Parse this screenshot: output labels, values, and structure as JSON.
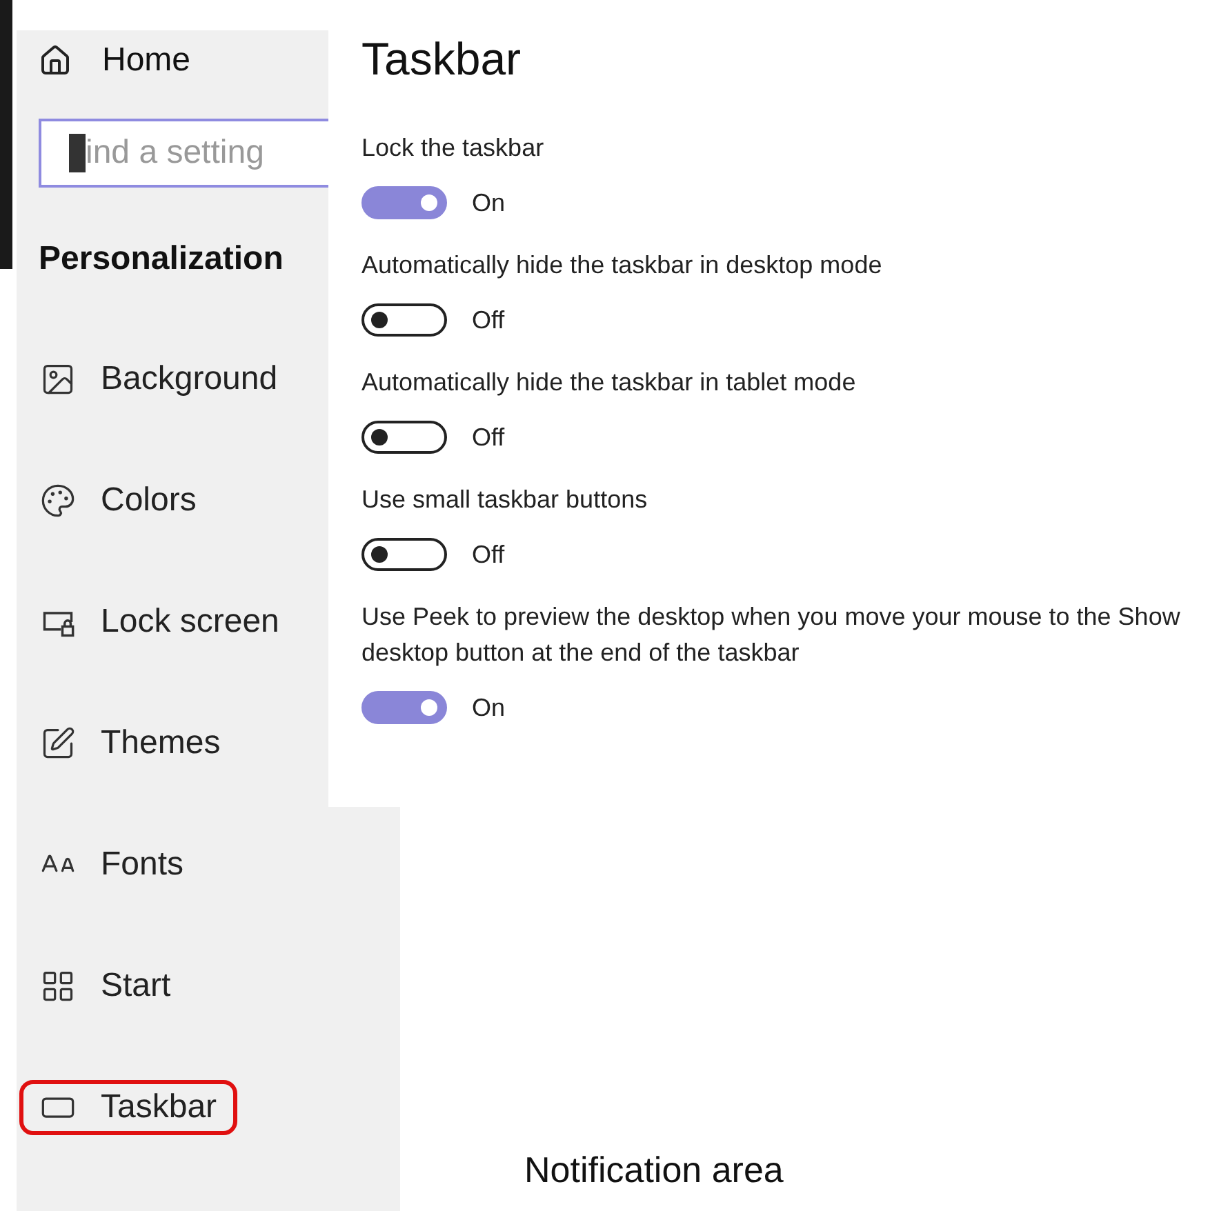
{
  "sidebar": {
    "home": "Home",
    "search": {
      "placeholder": "ind a setting"
    },
    "section": "Personalization",
    "items": [
      {
        "kind": "background",
        "label": "Background",
        "selected": false
      },
      {
        "kind": "colors",
        "label": "Colors",
        "selected": false
      },
      {
        "kind": "lockscreen",
        "label": "Lock screen",
        "selected": false
      },
      {
        "kind": "themes",
        "label": "Themes",
        "selected": false
      },
      {
        "kind": "fonts",
        "label": "Fonts",
        "selected": false
      },
      {
        "kind": "start",
        "label": "Start",
        "selected": false
      },
      {
        "kind": "taskbar",
        "label": "Taskbar",
        "selected": true
      }
    ]
  },
  "panel": {
    "title": "Taskbar",
    "settings": [
      {
        "label": "Lock the taskbar",
        "on": true,
        "state": "On"
      },
      {
        "label": "Automatically hide the taskbar in desktop mode",
        "on": false,
        "state": "Off"
      },
      {
        "label": "Automatically hide the taskbar in tablet mode",
        "on": false,
        "state": "Off"
      },
      {
        "label": "Use small taskbar buttons",
        "on": false,
        "state": "Off"
      },
      {
        "label": "Use Peek to preview the desktop when you move your mouse to the Show desktop button at the end of the taskbar",
        "on": true,
        "state": "On"
      }
    ]
  },
  "footer_label": "Notification area"
}
